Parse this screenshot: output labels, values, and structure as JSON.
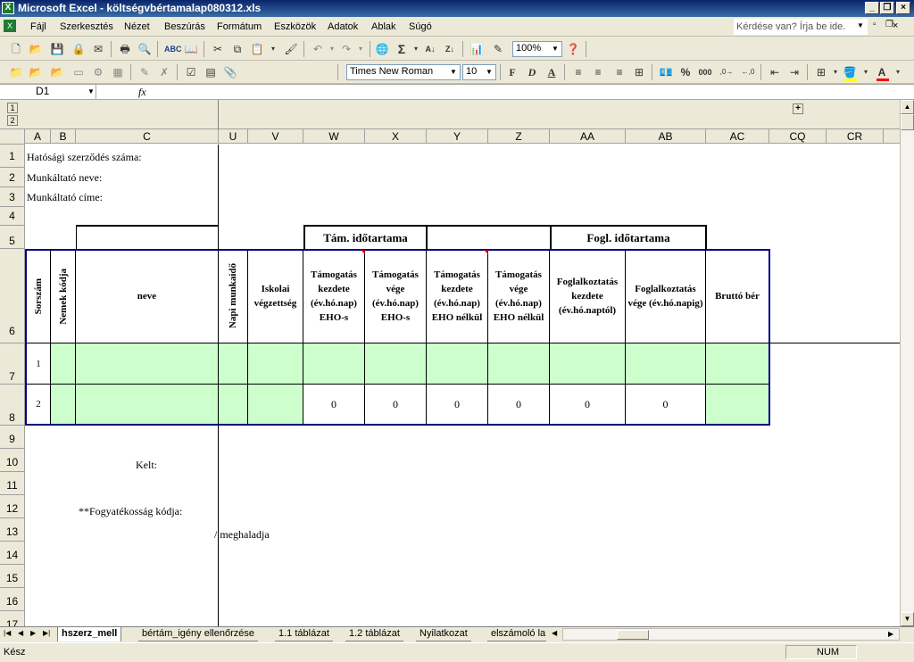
{
  "window": {
    "title": "Microsoft Excel - költségvbértamalap080312.xls",
    "app_icon": "excel-icon"
  },
  "menu": [
    "Fájl",
    "Szerkesztés",
    "Nézet",
    "Beszúrás",
    "Formátum",
    "Eszközök",
    "Adatok",
    "Ablak",
    "Súgó"
  ],
  "help_box": {
    "placeholder": "Kérdése van? Írja be ide."
  },
  "toolbar": {
    "zoom": "100%",
    "font_name": "Times New Roman",
    "font_size": "10",
    "sigma": "Σ"
  },
  "formula_bar": {
    "name_box": "D1",
    "fx": "fx",
    "value": ""
  },
  "outline": {
    "level1": "1",
    "level2": "2",
    "expand": "+"
  },
  "columns": [
    "A",
    "B",
    "C",
    "U",
    "V",
    "W",
    "X",
    "Y",
    "Z",
    "AA",
    "AB",
    "AC",
    "CQ",
    "CR"
  ],
  "rows": [
    "1",
    "2",
    "3",
    "4",
    "5",
    "6",
    "7",
    "8",
    "9",
    "10",
    "11",
    "12",
    "13",
    "14",
    "15",
    "16",
    "17"
  ],
  "cells": {
    "r1": "Hatósági szerződés száma:",
    "r2": "Munkáltató neve:",
    "r3": "Munkáltató címe:",
    "tam_idotartam": "Tám. időtartama",
    "fogl_idotartam": "Fogl. időtartama",
    "h_sorszam": "Sorszám",
    "h_nemek": "Nemek kódja",
    "h_neve": "neve",
    "h_napi": "Napi munkaidő",
    "h_iskolai": "Iskolai végzettség",
    "h_w": "Támogatás kezdete (év.hó.nap) EHO-s",
    "h_x": "Támogatás vége (év.hó.nap) EHO-s",
    "h_y": "Támogatás kezdete (év.hó.nap) EHO nélkül",
    "h_z": "Támogatás vége (év.hó.nap) EHO nélkül",
    "h_aa": "Foglalkoztatás kezdete (év.hó.naptól)",
    "h_ab": "Foglalkoztatás vége (év.hó.napig)",
    "h_ac": "Bruttó bér",
    "row7_no": "1",
    "row8_no": "2",
    "r8_w": "0",
    "r8_x": "0",
    "r8_y": "0",
    "r8_z": "0",
    "r8_aa": "0",
    "r8_ab": "0",
    "kelt": "Kelt:",
    "fogy": "**Fogyatékosság kódja:",
    "meghaladja": "/ meghaladja"
  },
  "sheet_tabs": [
    "hszerz_mell",
    "bértám_igény ellenőrzése",
    "1.1 táblázat",
    "1.2 táblázat",
    "Nyilatkozat",
    "elszámoló la"
  ],
  "active_tab": "hszerz_mell",
  "status": {
    "left": "Kész",
    "num": "NUM"
  },
  "colors": {
    "green_fill": "#ccffcc",
    "border_navy": "#000080",
    "title_gradient": "#0a246a"
  }
}
